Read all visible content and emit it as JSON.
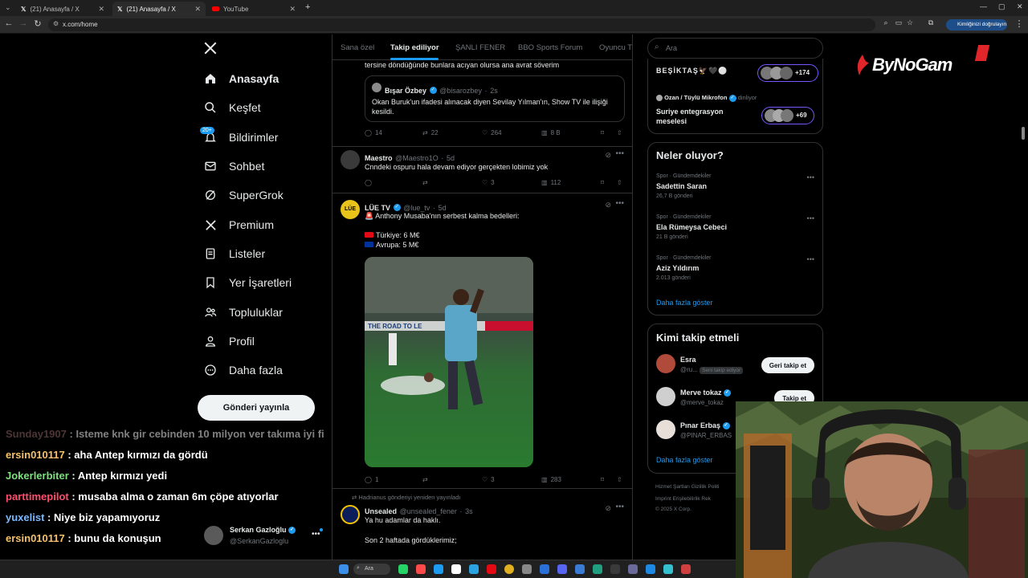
{
  "browser": {
    "tabs": [
      {
        "title": "(21) Anasayfa / X",
        "active": false
      },
      {
        "title": "(21) Anasayfa / X",
        "active": true
      },
      {
        "title": "YouTube",
        "active": false
      }
    ],
    "url": "x.com/home",
    "profile_label": "Kimliğinizi doğrulayın"
  },
  "nav": {
    "items": [
      {
        "label": "Anasayfa",
        "icon": "home-icon"
      },
      {
        "label": "Keşfet",
        "icon": "search-icon"
      },
      {
        "label": "Bildirimler",
        "icon": "bell-icon",
        "badge": "20+"
      },
      {
        "label": "Sohbet",
        "icon": "mail-icon"
      },
      {
        "label": "SuperGrok",
        "icon": "grok-icon"
      },
      {
        "label": "Premium",
        "icon": "x-logo-icon"
      },
      {
        "label": "Listeler",
        "icon": "list-icon"
      },
      {
        "label": "Yer İşaretleri",
        "icon": "bookmark-icon"
      },
      {
        "label": "Topluluklar",
        "icon": "people-icon"
      },
      {
        "label": "Profil",
        "icon": "person-icon"
      },
      {
        "label": "Daha fazla",
        "icon": "more-circle-icon"
      }
    ],
    "post_button": "Gönderi yayınla",
    "account": {
      "name": "Serkan Gazloğlu",
      "handle": "@SerkanGazloglu"
    }
  },
  "chat": [
    {
      "user": "Sunday1907",
      "color": "#9b6a6a",
      "message": "Isteme knk gir cebinden 10 milyon ver takıma iyi fi"
    },
    {
      "user": "ersin010117",
      "color": "#f5c26b",
      "message": "aha Antep kırmızı da gördü"
    },
    {
      "user": "Jokerlerbiter",
      "color": "#7fe07f",
      "message": "Antep kırmızı yedi"
    },
    {
      "user": "parttimepilot",
      "color": "#ff4d6d",
      "message": "musaba alma o zaman 6m çöpe atıyorlar"
    },
    {
      "user": "yuxelist",
      "color": "#7ab8ff",
      "message": "Niye biz yapamıyoruz"
    },
    {
      "user": "ersin010117",
      "color": "#f5c26b",
      "message": "bunu da konuşun"
    }
  ],
  "feed": {
    "tabs": [
      "Sana özel",
      "Takip ediliyor",
      "ŞANLI FENER",
      "BBO Sports Forum",
      "Oyuncu T"
    ],
    "active_tab": "Takip ediliyor",
    "tweet1": {
      "text": "tersine döndüğünde bunlara acıyan olursa ana avrat söverim",
      "quote": {
        "name": "Bışar Özbey",
        "handle": "@bisarozbey",
        "time": "2s",
        "text": "Okan Buruk'un ifadesi alınacak diyen Sevilay Yılman'ın, Show TV ile ilişiği kesildi."
      },
      "stats": {
        "replies": "14",
        "reposts": "22",
        "likes": "264",
        "views": "8 B"
      }
    },
    "tweet2": {
      "name": "Maestro",
      "handle": "@Maestro1O",
      "time": "5d",
      "text": "Cnndeki ospuru hala devam ediyor gerçekten lobimiz yok",
      "stats": {
        "replies": "",
        "reposts": "",
        "likes": "3",
        "views": "112"
      }
    },
    "tweet3": {
      "name": "LÜE TV",
      "handle": "@lue_tv",
      "time": "5d",
      "line1": "🚨 Anthony Musaba'nın serbest kalma bedelleri:",
      "line2": "Türkiye: 6 M€",
      "line3": "Avrupa: 5 M€",
      "image_text": "THE ROAD TO LE",
      "stats": {
        "replies": "1",
        "reposts": "",
        "likes": "3",
        "views": "283"
      }
    },
    "tweet4": {
      "repost_note": "Hadrianus gönderiyi yeniden yayınladı",
      "name": "Unsealed",
      "handle": "@unsealed_fener",
      "time": "3s",
      "line1": "Ya hu adamlar da haklı.",
      "line2": "Son 2 haftada gördüklerimiz;"
    }
  },
  "right": {
    "search_placeholder": "Ara",
    "spaces": [
      {
        "title": "BEŞİKTAŞ🦅🖤⚪",
        "count": "+174"
      },
      {
        "host": "Ozan / Tüylü Mikrofon",
        "status": "dinliyor",
        "title": "Suriye entegrasyon meselesi",
        "count": "+69"
      }
    ],
    "trends_title": "Neler oluyor?",
    "trends": [
      {
        "category": "Spor · Gündemdekiler",
        "name": "Sadettin Saran",
        "count": "26,7 B gönderi"
      },
      {
        "category": "Spor · Gündemdekiler",
        "name": "Ela Rümeysa Cebeci",
        "count": "21 B gönderi"
      },
      {
        "category": "Spor · Gündemdekiler",
        "name": "Aziz Yıldırım",
        "count": "2.013 gönderi"
      }
    ],
    "show_more": "Daha fazla göster",
    "who_title": "Kimi takip etmeli",
    "who": [
      {
        "name": "Esra",
        "handle": "@ru...",
        "note": "Seni takip ediyor",
        "button": "Geri takip et"
      },
      {
        "name": "Merve tokaz",
        "handle": "@merve_tokaz",
        "note": "",
        "button": "Takip et"
      },
      {
        "name": "Pınar Erbaş",
        "handle": "@PINAR_ERBAS",
        "note": "",
        "button": ""
      }
    ],
    "who_more": "Daha fazla göster",
    "footer1": "Hizmet Şartları   Gizlilik Politi",
    "footer2": "Imprint   Erişilebilirlik   Rek",
    "footer3": "© 2025 X Corp."
  },
  "overlay": {
    "logo": "ByNoGam"
  },
  "taskbar": {
    "search": "Ara"
  },
  "colors": {
    "accent": "#1d9bf0",
    "bg": "#000000",
    "border": "#2f3336",
    "muted": "#71767b"
  }
}
